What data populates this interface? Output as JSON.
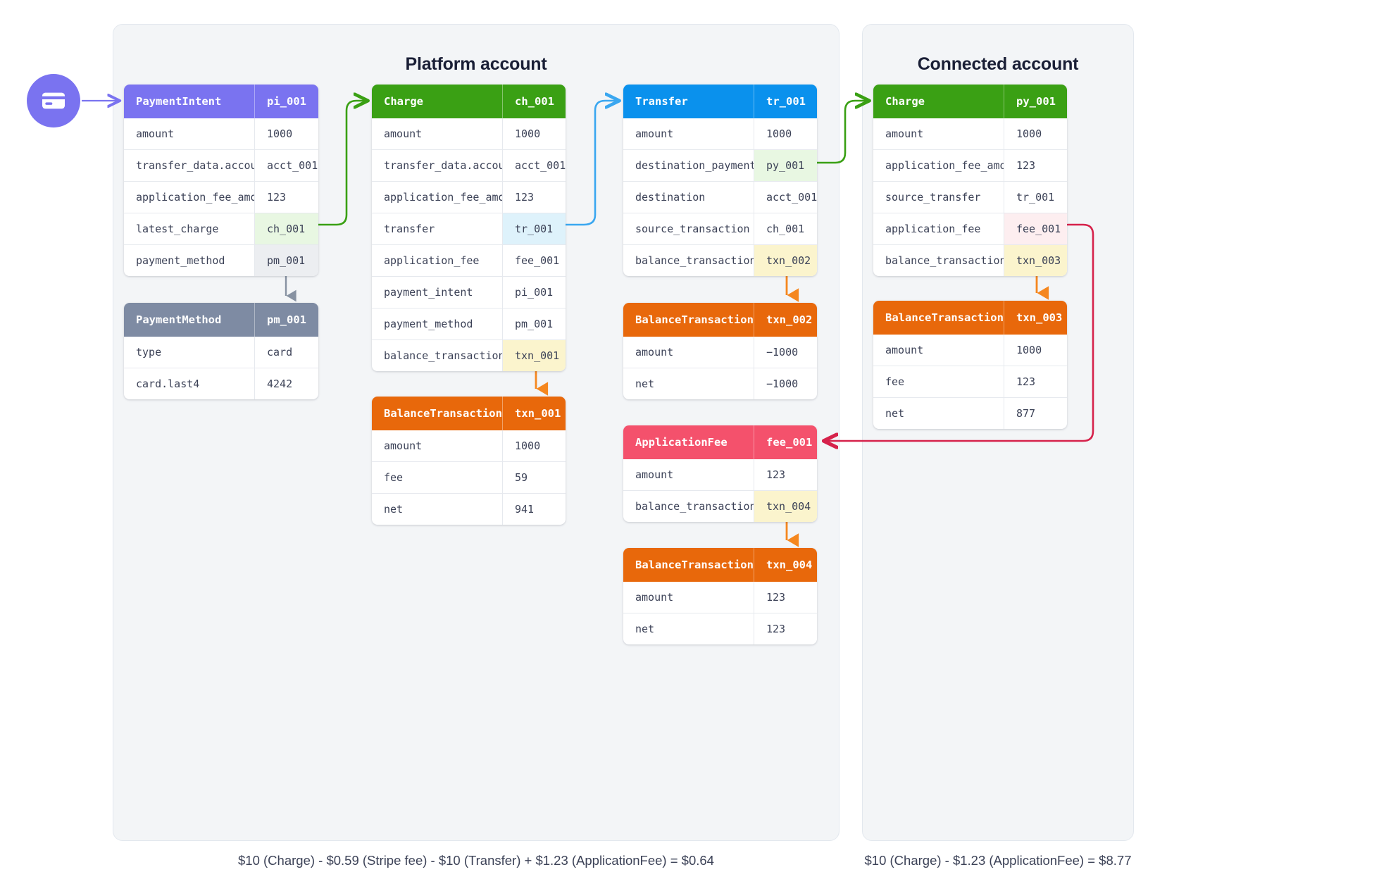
{
  "panels": {
    "platform": {
      "title": "Platform account",
      "caption": "$10 (Charge) - $0.59 (Stripe fee) - $10 (Transfer) + $1.23 (ApplicationFee) = $0.64"
    },
    "connected": {
      "title": "Connected account",
      "caption": "$10 (Charge) - $1.23 (ApplicationFee) = $8.77"
    }
  },
  "icons": {
    "card": "credit-card-icon"
  },
  "objects": {
    "payment_intent": {
      "type": "PaymentIntent",
      "id": "pi_001",
      "rows": [
        {
          "key": "amount",
          "value": "1000",
          "highlight": "none"
        },
        {
          "key": "transfer_data.account",
          "value": "acct_001",
          "highlight": "none"
        },
        {
          "key": "application_fee_amount",
          "value": "123",
          "highlight": "none"
        },
        {
          "key": "latest_charge",
          "value": "ch_001",
          "highlight": "green"
        },
        {
          "key": "payment_method",
          "value": "pm_001",
          "highlight": "grey"
        }
      ]
    },
    "payment_method": {
      "type": "PaymentMethod",
      "id": "pm_001",
      "rows": [
        {
          "key": "type",
          "value": "card",
          "highlight": "none"
        },
        {
          "key": "card.last4",
          "value": "4242",
          "highlight": "none"
        }
      ]
    },
    "charge": {
      "type": "Charge",
      "id": "ch_001",
      "rows": [
        {
          "key": "amount",
          "value": "1000",
          "highlight": "none"
        },
        {
          "key": "transfer_data.account",
          "value": "acct_001",
          "highlight": "none"
        },
        {
          "key": "application_fee_amount",
          "value": "123",
          "highlight": "none"
        },
        {
          "key": "transfer",
          "value": "tr_001",
          "highlight": "blue"
        },
        {
          "key": "application_fee",
          "value": "fee_001",
          "highlight": "none"
        },
        {
          "key": "payment_intent",
          "value": "pi_001",
          "highlight": "none"
        },
        {
          "key": "payment_method",
          "value": "pm_001",
          "highlight": "none"
        },
        {
          "key": "balance_transaction",
          "value": "txn_001",
          "highlight": "yellow"
        }
      ]
    },
    "balance_txn_001": {
      "type": "BalanceTransaction",
      "id": "txn_001",
      "rows": [
        {
          "key": "amount",
          "value": "1000",
          "highlight": "none"
        },
        {
          "key": "fee",
          "value": "59",
          "highlight": "none"
        },
        {
          "key": "net",
          "value": "941",
          "highlight": "none"
        }
      ]
    },
    "transfer": {
      "type": "Transfer",
      "id": "tr_001",
      "rows": [
        {
          "key": "amount",
          "value": "1000",
          "highlight": "none"
        },
        {
          "key": "destination_payment",
          "value": "py_001",
          "highlight": "green"
        },
        {
          "key": "destination",
          "value": "acct_001",
          "highlight": "none"
        },
        {
          "key": "source_transaction",
          "value": "ch_001",
          "highlight": "none"
        },
        {
          "key": "balance_transaction",
          "value": "txn_002",
          "highlight": "yellow"
        }
      ]
    },
    "balance_txn_002": {
      "type": "BalanceTransaction",
      "id": "txn_002",
      "rows": [
        {
          "key": "amount",
          "value": "−1000",
          "highlight": "none"
        },
        {
          "key": "net",
          "value": "−1000",
          "highlight": "none"
        }
      ]
    },
    "application_fee": {
      "type": "ApplicationFee",
      "id": "fee_001",
      "rows": [
        {
          "key": "amount",
          "value": "123",
          "highlight": "none"
        },
        {
          "key": "balance_transaction",
          "value": "txn_004",
          "highlight": "yellow"
        }
      ]
    },
    "balance_txn_004": {
      "type": "BalanceTransaction",
      "id": "txn_004",
      "rows": [
        {
          "key": "amount",
          "value": "123",
          "highlight": "none"
        },
        {
          "key": "net",
          "value": "123",
          "highlight": "none"
        }
      ]
    },
    "connected_charge": {
      "type": "Charge",
      "id": "py_001",
      "rows": [
        {
          "key": "amount",
          "value": "1000",
          "highlight": "none"
        },
        {
          "key": "application_fee_amount",
          "value": "123",
          "highlight": "none"
        },
        {
          "key": "source_transfer",
          "value": "tr_001",
          "highlight": "none"
        },
        {
          "key": "application_fee",
          "value": "fee_001",
          "highlight": "pink"
        },
        {
          "key": "balance_transaction",
          "value": "txn_003",
          "highlight": "yellow"
        }
      ]
    },
    "balance_txn_003": {
      "type": "BalanceTransaction",
      "id": "txn_003",
      "rows": [
        {
          "key": "amount",
          "value": "1000",
          "highlight": "none"
        },
        {
          "key": "fee",
          "value": "123",
          "highlight": "none"
        },
        {
          "key": "net",
          "value": "877",
          "highlight": "none"
        }
      ]
    }
  },
  "colors": {
    "purple": "#7a73f0",
    "green": "#3aa014",
    "blue": "#0a91ed",
    "orange": "#e8680b",
    "slate": "#7e8ba3",
    "pink": "#f4516c",
    "panel_bg": "#f3f5f7"
  }
}
